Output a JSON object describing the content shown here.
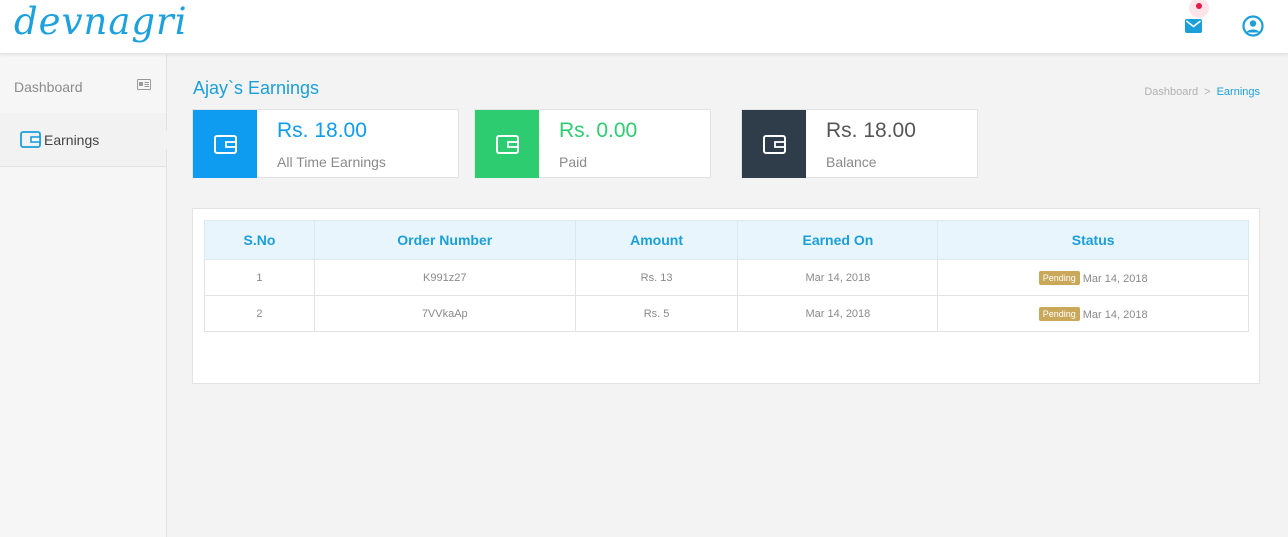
{
  "app": {
    "logo_text": "devnagri"
  },
  "sidebar": {
    "items": [
      {
        "label": "Dashboard"
      },
      {
        "label": "Earnings"
      }
    ]
  },
  "page": {
    "title": "Ajay`s Earnings"
  },
  "breadcrumb": {
    "home": "Dashboard",
    "separator": ">",
    "current": "Earnings"
  },
  "cards": [
    {
      "value": "Rs. 18.00",
      "label": "All Time Earnings",
      "color": "#0d9cf0",
      "icon": "wallet-icon"
    },
    {
      "value": "Rs. 0.00",
      "label": "Paid",
      "color": "#2ecc71",
      "icon": "wallet-icon"
    },
    {
      "value": "Rs. 18.00",
      "label": "Balance",
      "color": "#2f3d4a",
      "icon": "wallet-icon"
    }
  ],
  "table": {
    "headers": [
      "S.No",
      "Order Number",
      "Amount",
      "Earned On",
      "Status"
    ],
    "rows": [
      {
        "sno": "1",
        "order": "K991z27",
        "amount": "Rs. 13",
        "earned": "Mar 14, 2018",
        "status": "Pending",
        "status_date": "Mar 14, 2018"
      },
      {
        "sno": "2",
        "order": "7VVkaAp",
        "amount": "Rs. 5",
        "earned": "Mar 14, 2018",
        "status": "Pending",
        "status_date": "Mar 14, 2018"
      }
    ]
  },
  "colors": {
    "accent": "#1a9fd9",
    "pending_badge": "#c9a85a",
    "notification_dot": "#e8194a"
  }
}
